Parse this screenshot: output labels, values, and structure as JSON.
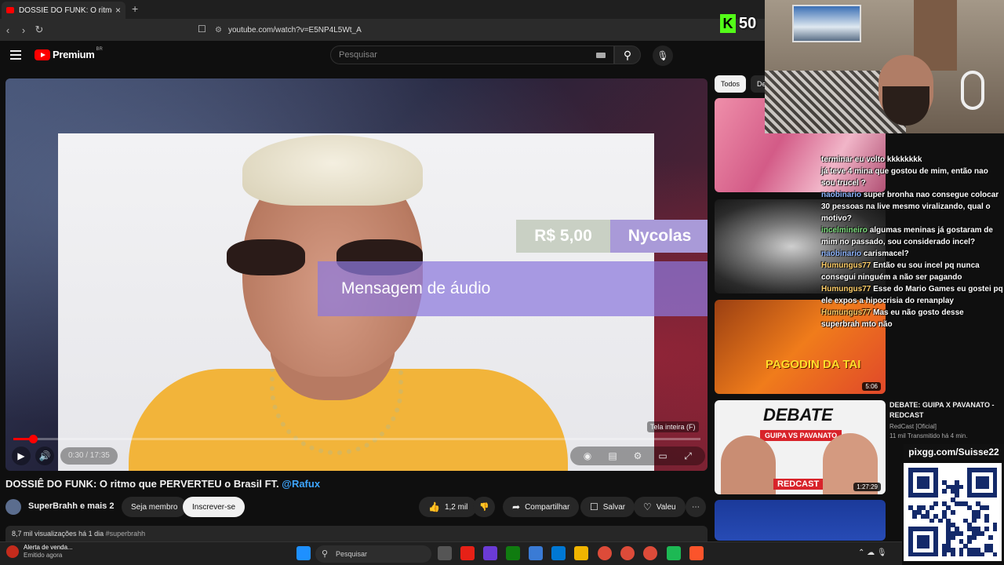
{
  "browser": {
    "tab_title": "DOSSIÊ DO FUNK: O ritmo que P",
    "tab_close": "×",
    "new_tab": "+",
    "url": "youtube.com/watch?v=E5NP4L5Wt_A"
  },
  "header": {
    "logo": "Premium",
    "logo_region": "BR",
    "search_placeholder": "Pesquisar"
  },
  "player": {
    "donation_amount": "R$ 5,00",
    "donation_name": "Nycolas",
    "audio_message": "Mensagem de áudio",
    "fullscreen_tip": "Tela inteira (F)",
    "time": "0:30 / 17:35",
    "progress": 0.028
  },
  "video": {
    "title": "DOSSIÊ DO FUNK: O ritmo que PERVERTEU o Brasil FT.",
    "title_tag": "@Rafux",
    "channel": "SuperBrahh e mais 2",
    "member_button": "Seja membro",
    "subscribe_button": "Inscrever-se",
    "likes": "1,2 mil",
    "share": "Compartilhar",
    "save": "Salvar",
    "thanks": "Valeu",
    "views": "8,7 mil visualizações",
    "age": "há 1 dia",
    "hashtag": "#superbrahh"
  },
  "sidebar": {
    "chip_all": "Todos",
    "chip_more": "De",
    "rec1_dur": "",
    "rec2_dur": "",
    "rec3_text": "PAGODIN DA TAI",
    "rec3_dur": "5:06",
    "rec4_debate": "DEBATE",
    "rec4_vs": "GUIPA VS PAVANATO",
    "rec4_brand": "REDCAST",
    "rec4_dur": "1:27:29",
    "rec4_title": "DEBATE: GUIPA X PAVANATO - REDCAST",
    "rec4_channel": "RedCast [Oficial]",
    "rec4_meta": "11 mil  Transmitido há 4 min."
  },
  "overlay": {
    "kick_count": "50",
    "pix": "pixgg.com/Suisse22"
  },
  "chat": [
    {
      "user": "",
      "msg": "terminar eu volto kkkkkkkk"
    },
    {
      "user": "",
      "msg": "já teve 4 mina que gostou de mim, então nao sou trucel ?"
    },
    {
      "user": "naobinario",
      "msg": "super bronha nao consegue colocar 30 pessoas na live mesmo viralizando, qual o motivo?"
    },
    {
      "user": "incelmineiro",
      "msg": "algumas meninas já gostaram de mim no passado, sou considerado incel?"
    },
    {
      "user": "naobinario",
      "msg": "carismacel?"
    },
    {
      "user": "Humungus77",
      "msg": "Então eu sou incel pq nunca consegui ninguém a não ser pagando"
    },
    {
      "user": "Humungus77",
      "msg": "Esse do Mario Games eu gostei pq ele expos a hipocrisia do renanplay"
    },
    {
      "user": "Humungus77",
      "msg": "Mas eu não gosto desse superbrah mto não"
    }
  ],
  "taskbar": {
    "alert_title": "Alerta de venda...",
    "alert_sub": "Emitido agora",
    "search": "Pesquisar"
  }
}
